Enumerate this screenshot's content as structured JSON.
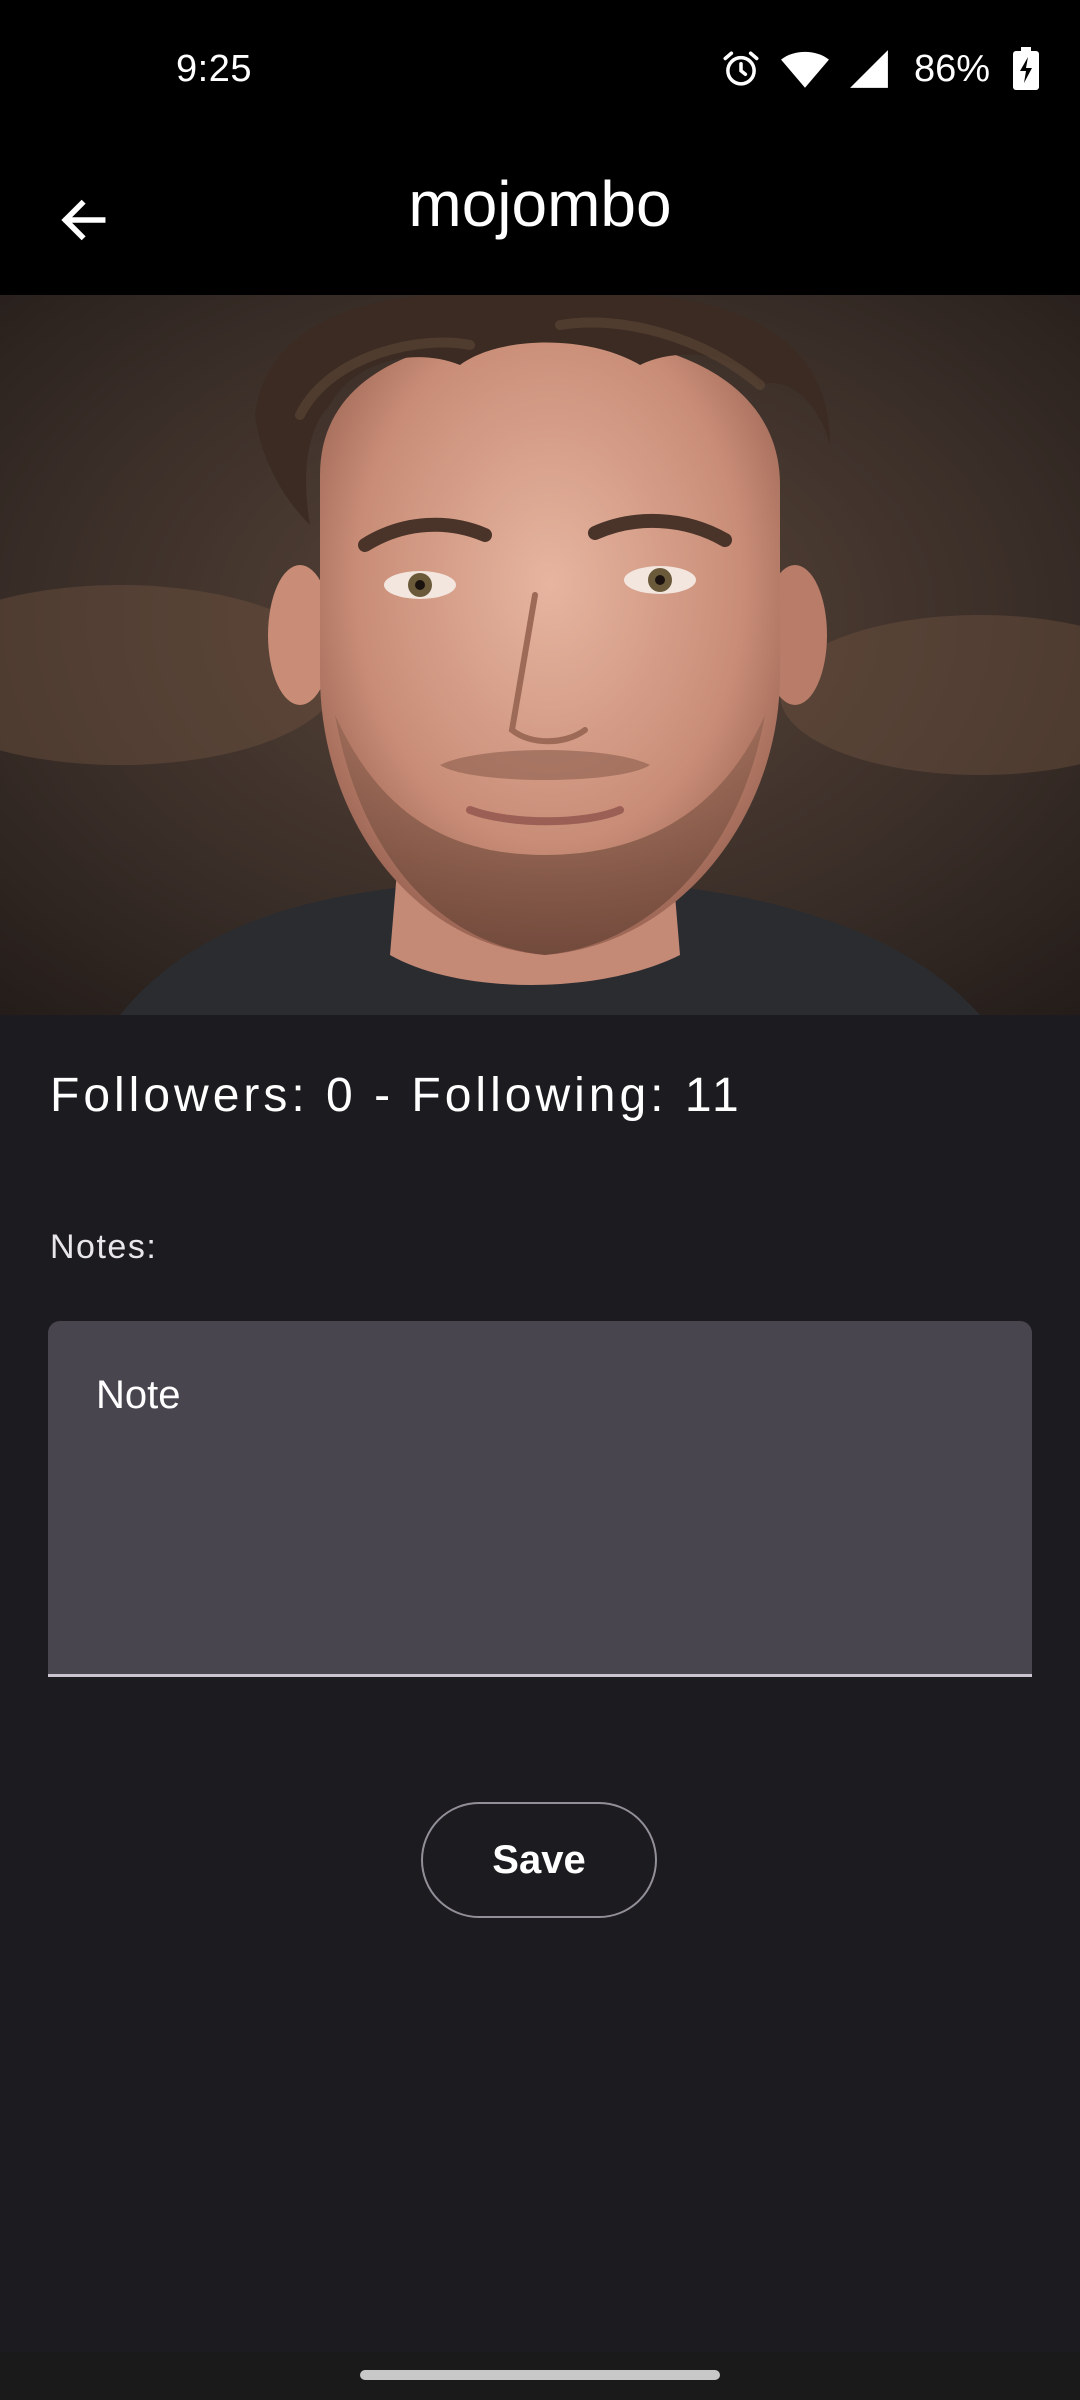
{
  "status_bar": {
    "time": "9:25",
    "battery_percent": "86%",
    "icons": [
      "alarm-icon",
      "wifi-icon",
      "cellular-signal-icon",
      "battery-charging-icon"
    ]
  },
  "app_bar": {
    "title": "mojombo",
    "back_icon": "arrow-back-icon"
  },
  "profile": {
    "photo": "profile-photo"
  },
  "stats": {
    "text": "Followers: 0 - Following: 11",
    "followers": 0,
    "following": 11
  },
  "notes": {
    "label": "Notes:",
    "placeholder": "Note",
    "value": ""
  },
  "actions": {
    "save_label": "Save"
  },
  "colors": {
    "background": "#1c1b1f",
    "app_bar": "#000000",
    "field_fill": "#49454f",
    "outline": "#938f99"
  }
}
